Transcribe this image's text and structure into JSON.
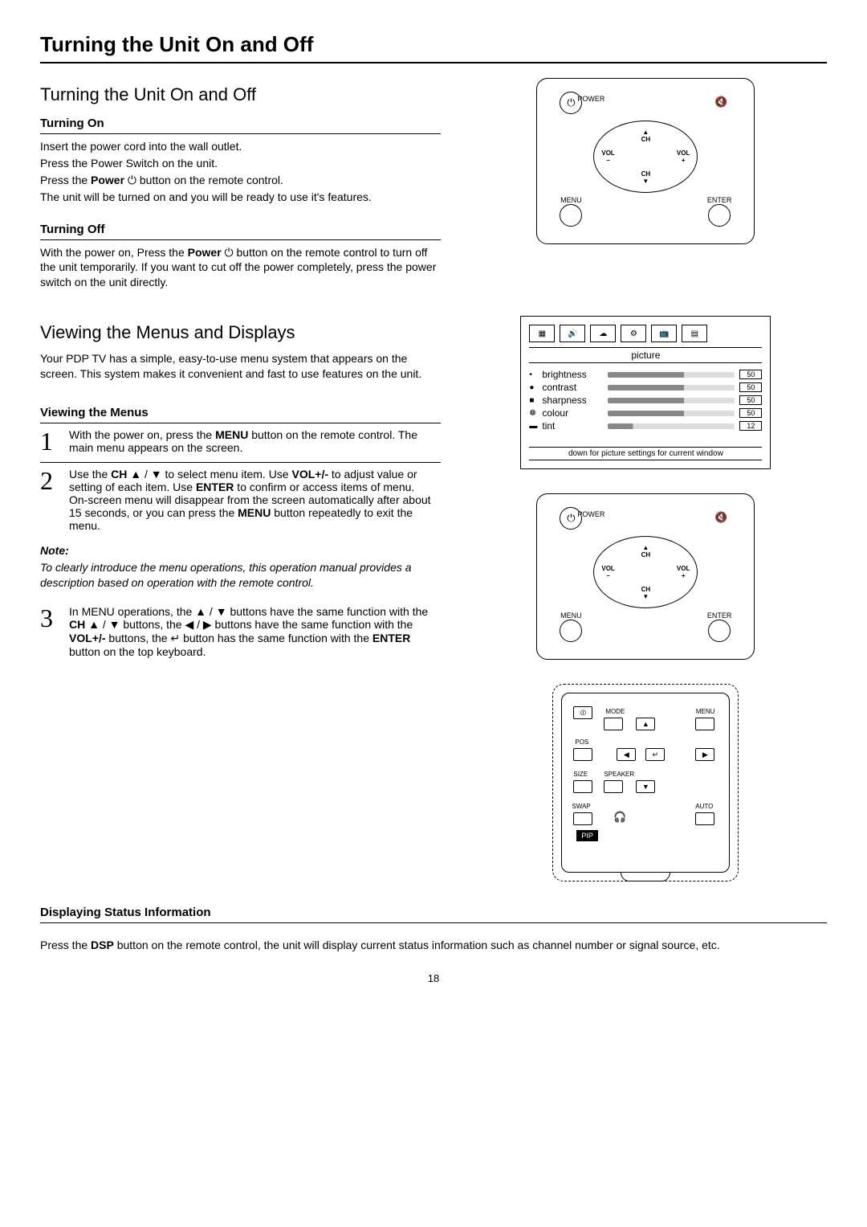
{
  "page_title": "Turning the Unit On and Off",
  "section1": {
    "heading": "Turning the Unit On and Off",
    "turning_on": {
      "title": "Turning On",
      "l1": "Insert the power cord into the wall outlet.",
      "l2": "Press the Power Switch on the unit.",
      "l3a": "Press the ",
      "l3b": "Power",
      "l3c": " ⏻ button on the remote control.",
      "l4": "The unit will be turned on and you will be ready to use it's features."
    },
    "turning_off": {
      "title": "Turning Off",
      "p1a": "With the power on, Press the ",
      "p1b": "Power",
      "p1c": " ⏻ button on the remote control to turn off the unit temporarily. If you want to cut off the power completely, press the power switch on the unit directly."
    }
  },
  "section2": {
    "heading": "Viewing the Menus and Displays",
    "intro": "Your PDP TV has a simple, easy-to-use menu system that appears on the screen. This system makes it convenient and fast to use features on the unit.",
    "viewing_title": "Viewing the Menus",
    "step1": {
      "num": "1",
      "a": "With the power on, press the ",
      "b": "MENU",
      "c": " button on the remote control. The main menu appears on the screen."
    },
    "step2": {
      "num": "2",
      "a": "Use the ",
      "b": "CH",
      "c": " ▲ / ▼ to select menu item. Use ",
      "d": "VOL+/-",
      "e": " to adjust value or setting of each item. Use ",
      "f": "ENTER",
      "g": " to confirm or access items of menu.",
      "h": "On-screen menu will disappear from the screen automatically after about 15 seconds, or you can press the ",
      "i": "MENU",
      "j": " button repeatedly to exit the menu."
    },
    "note_head": "Note:",
    "note_body": "To clearly introduce the menu operations, this operation manual provides a description based on operation with the remote control.",
    "step3": {
      "num": "3",
      "a": "In MENU operations, the ▲ / ▼ buttons have the same function with the ",
      "b": "CH",
      "c": " ▲ / ▼ buttons, the ◀ / ▶ buttons have the same function with the ",
      "d": "VOL+/-",
      "e": " buttons, the ↵ button has the same function with the ",
      "f": "ENTER",
      "g": " button on the top keyboard."
    }
  },
  "status": {
    "title": "Displaying Status Information",
    "a": "Press the ",
    "b": "DSP",
    "c": " button on the remote control, the unit will display current status information such as channel number or signal source, etc."
  },
  "remote": {
    "power": "POWER",
    "ch": "CH",
    "vol": "VOL",
    "minus": "–",
    "plus": "+",
    "menu": "MENU",
    "enter": "ENTER",
    "mute_icon": "🔇",
    "power_icon": "⏻"
  },
  "osd": {
    "tab_icons": [
      "▦",
      "🔊",
      "☁",
      "⚙",
      "📺",
      "▤"
    ],
    "title": "picture",
    "rows": [
      {
        "dot": "•",
        "name": "brightness",
        "val": "50"
      },
      {
        "dot": "●",
        "name": "contrast",
        "val": "50"
      },
      {
        "dot": "■",
        "name": "sharpness",
        "val": "50"
      },
      {
        "dot": "❁",
        "name": "colour",
        "val": "50"
      },
      {
        "dot": "▬",
        "name": "tint",
        "val": "12"
      }
    ],
    "hint": "down for picture settings for current window"
  },
  "kbd": {
    "mode": "MODE",
    "menu": "MENU",
    "pos": "POS",
    "size": "SIZE",
    "speaker": "SPEAKER",
    "swap": "SWAP",
    "auto": "AUTO",
    "pip": "PIP",
    "up": "▲",
    "down": "▼",
    "left": "◀",
    "right": "▶",
    "enter": "↵",
    "hp": "🎧",
    "pwr": "⏼"
  },
  "page_number": "18"
}
